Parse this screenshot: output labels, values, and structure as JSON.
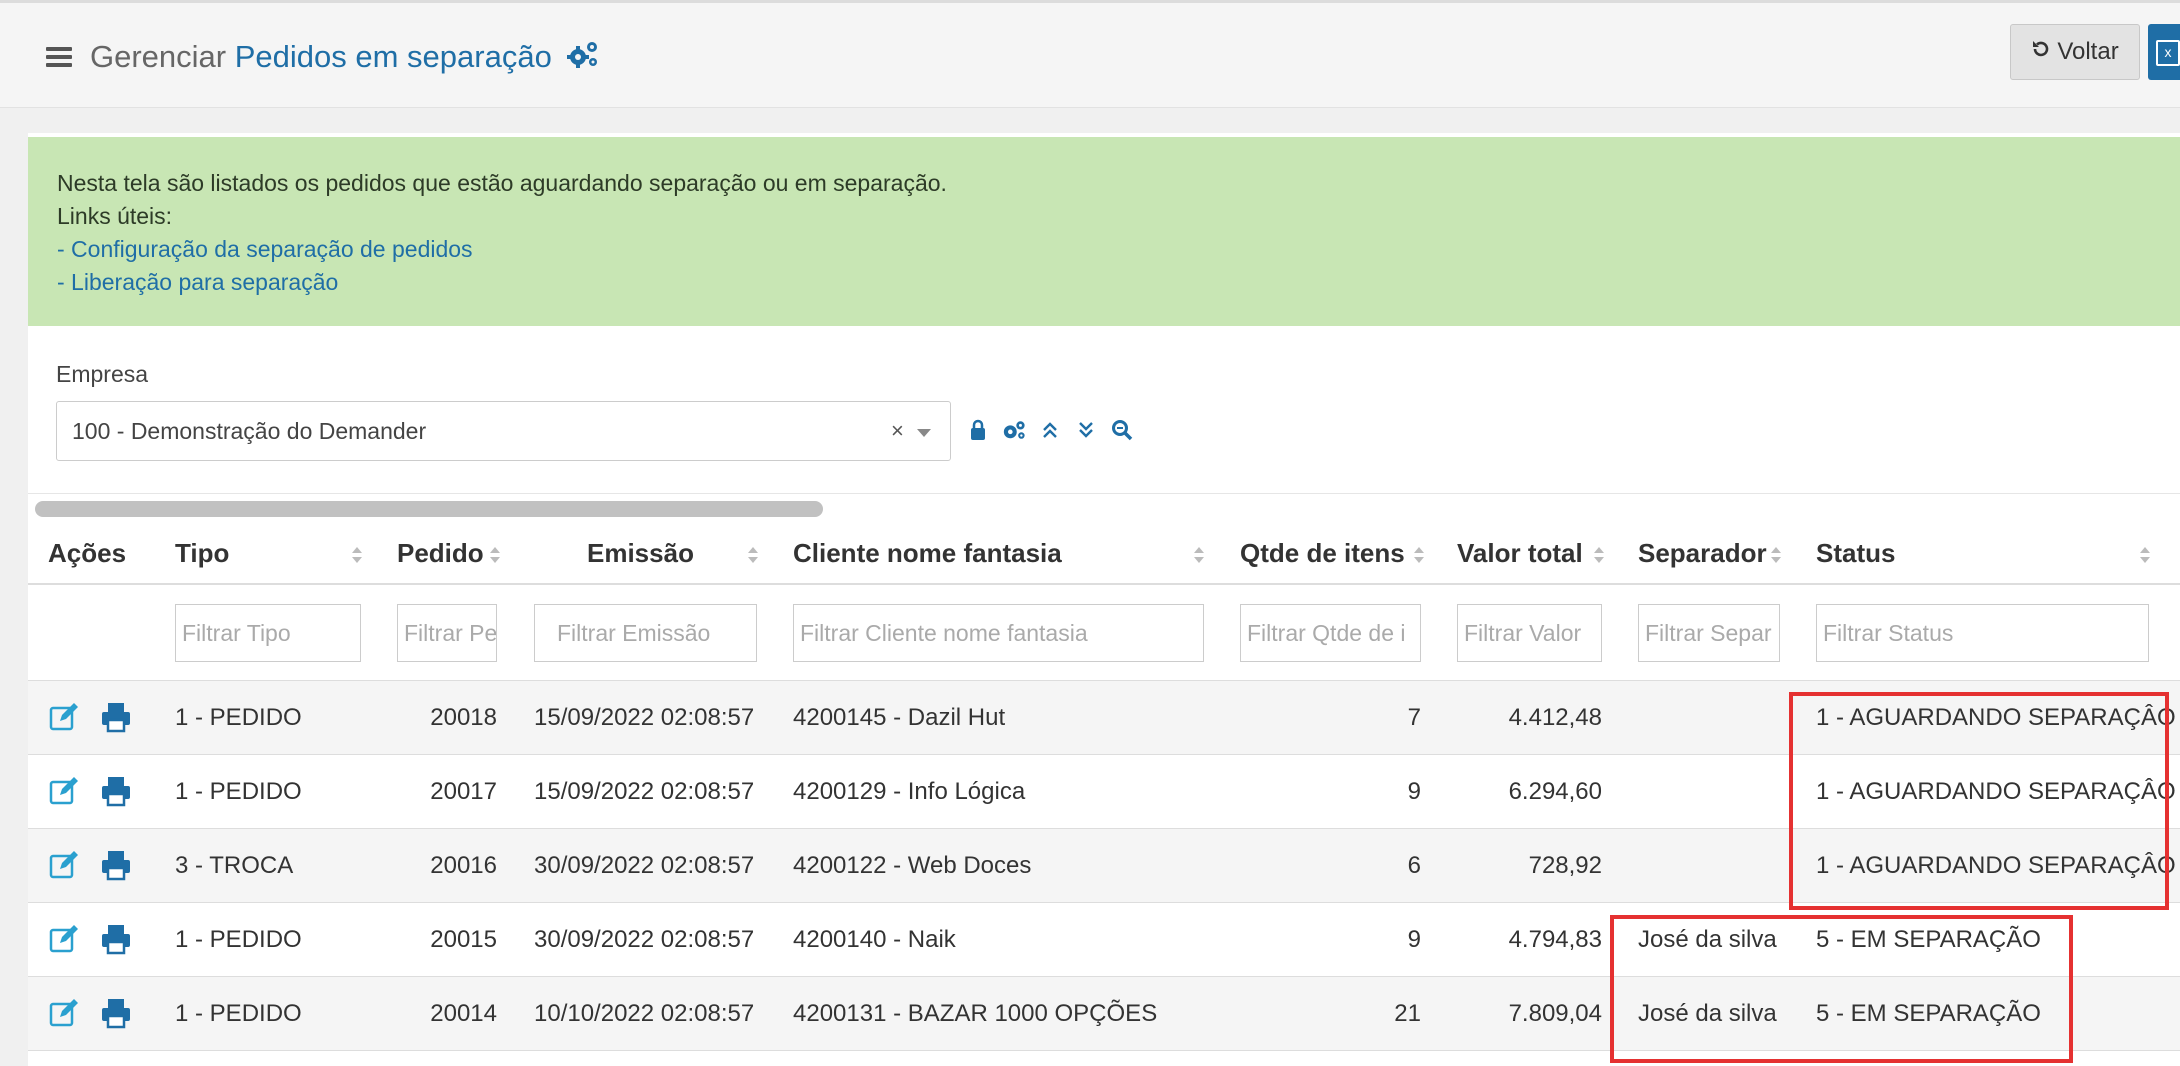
{
  "header": {
    "title_prefix": "Gerenciar",
    "title_main": "Pedidos em separação",
    "back_label": "Voltar"
  },
  "info": {
    "text": "Nesta tela são listados os pedidos que estão aguardando separação ou em separação.",
    "links_label": "Links úteis:",
    "link_1": "- Configuração da separação de pedidos",
    "link_2": "- Liberação para separação"
  },
  "empresa": {
    "label": "Empresa",
    "value": "100 - Demonstração do Demander",
    "clear": "×"
  },
  "table": {
    "headers": {
      "acoes": "Ações",
      "tipo": "Tipo",
      "pedido": "Pedido",
      "emissao": "Emissão",
      "cliente": "Cliente nome fantasia",
      "qtde": "Qtde de itens",
      "valor": "Valor total",
      "separador": "Separador",
      "status": "Status"
    },
    "filters": {
      "tipo": "Filtrar Tipo",
      "pedido": "Filtrar Pe",
      "emissao": "Filtrar Emissão",
      "cliente": "Filtrar Cliente nome fantasia",
      "qtde": "Filtrar Qtde de i",
      "valor": "Filtrar Valor",
      "separador": "Filtrar Separ",
      "status": "Filtrar Status"
    },
    "rows": [
      {
        "tipo": "1 - PEDIDO",
        "pedido": "20018",
        "emissao": "15/09/2022 02:08:57",
        "cliente": "4200145 - Dazil Hut",
        "qtde": "7",
        "valor": "4.412,48",
        "separador": "",
        "status": "1 - AGUARDANDO SEPARAÇÂO"
      },
      {
        "tipo": "1 - PEDIDO",
        "pedido": "20017",
        "emissao": "15/09/2022 02:08:57",
        "cliente": "4200129 - Info Lógica",
        "qtde": "9",
        "valor": "6.294,60",
        "separador": "",
        "status": "1 - AGUARDANDO SEPARAÇÂO"
      },
      {
        "tipo": "3 - TROCA",
        "pedido": "20016",
        "emissao": "30/09/2022 02:08:57",
        "cliente": "4200122 - Web Doces",
        "qtde": "6",
        "valor": "728,92",
        "separador": "",
        "status": "1 - AGUARDANDO SEPARAÇÂO"
      },
      {
        "tipo": "1 - PEDIDO",
        "pedido": "20015",
        "emissao": "30/09/2022 02:08:57",
        "cliente": "4200140 - Naik",
        "qtde": "9",
        "valor": "4.794,83",
        "separador": "José da silva",
        "status": "5 - EM SEPARAÇÃO"
      },
      {
        "tipo": "1 - PEDIDO",
        "pedido": "20014",
        "emissao": "10/10/2022 02:08:57",
        "cliente": "4200131 - BAZAR 1000 OPÇÕES",
        "qtde": "21",
        "valor": "7.809,04",
        "separador": "José da silva",
        "status": "5 - EM SEPARAÇÃO"
      }
    ]
  },
  "colors": {
    "brand_blue": "#1f6ea6",
    "alert_green": "#c8e6b4",
    "highlight_red": "#e53131"
  }
}
